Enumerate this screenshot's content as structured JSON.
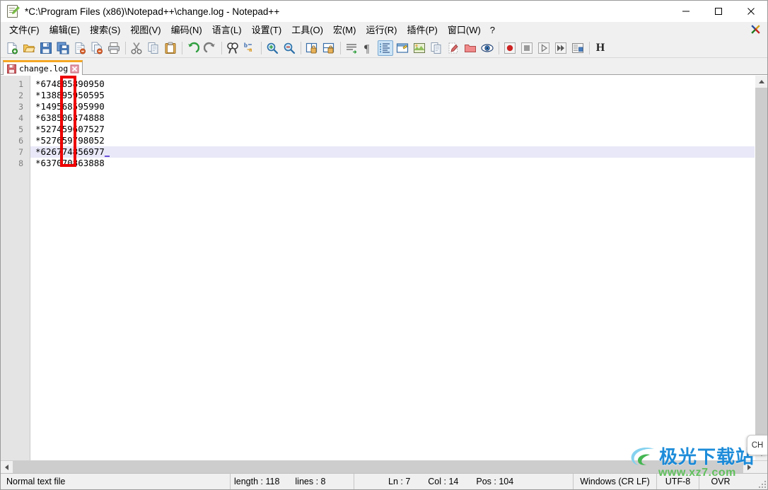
{
  "window": {
    "title": "*C:\\Program Files (x86)\\Notepad++\\change.log - Notepad++",
    "app_icon": "notepad-plus-plus-icon",
    "controls": {
      "minimize": "minimize-button",
      "maximize": "maximize-button",
      "close": "close-button"
    }
  },
  "menubar": {
    "items": [
      {
        "label": "文件(F)",
        "name": "menu-file"
      },
      {
        "label": "编辑(E)",
        "name": "menu-edit"
      },
      {
        "label": "搜索(S)",
        "name": "menu-search"
      },
      {
        "label": "视图(V)",
        "name": "menu-view"
      },
      {
        "label": "编码(N)",
        "name": "menu-encoding"
      },
      {
        "label": "语言(L)",
        "name": "menu-language"
      },
      {
        "label": "设置(T)",
        "name": "menu-settings"
      },
      {
        "label": "工具(O)",
        "name": "menu-tools"
      },
      {
        "label": "宏(M)",
        "name": "menu-macro"
      },
      {
        "label": "运行(R)",
        "name": "menu-run"
      },
      {
        "label": "插件(P)",
        "name": "menu-plugins"
      },
      {
        "label": "窗口(W)",
        "name": "menu-window"
      },
      {
        "label": "?",
        "name": "menu-help"
      }
    ],
    "close_document": "close-document-x-icon"
  },
  "toolbar": {
    "groups": [
      [
        "new-file-icon",
        "open-file-icon",
        "save-icon",
        "save-all-icon",
        "close-file-icon",
        "close-all-files-icon",
        "print-icon"
      ],
      [
        "cut-icon",
        "copy-icon",
        "paste-icon"
      ],
      [
        "undo-icon",
        "redo-icon"
      ],
      [
        "find-icon",
        "replace-icon"
      ],
      [
        "zoom-in-icon",
        "zoom-out-icon"
      ],
      [
        "sync-vertical-scrolling-icon",
        "sync-horizontal-scrolling-icon"
      ],
      [
        "word-wrap-icon",
        "show-all-characters-icon",
        "indent-guide-icon",
        "user-defined-dialog-icon",
        "document-map-icon",
        "document-list-icon",
        "function-list-icon",
        "folder-as-workspace-icon",
        "monitoring-icon"
      ],
      [
        "record-macro-icon",
        "stop-recording-icon",
        "play-macro-icon",
        "run-macro-multiple-times-icon",
        "save-current-macro-icon"
      ],
      [
        "highlight-icon"
      ]
    ],
    "active_tool": "indent-guide-icon"
  },
  "tabs": [
    {
      "label": "change.log",
      "modified": true,
      "active": true,
      "save_icon": "unsaved-save-icon",
      "close_icon": "tab-close-icon"
    }
  ],
  "editor": {
    "line_numbers": [
      "1",
      "2",
      "3",
      "4",
      "5",
      "6",
      "7",
      "8"
    ],
    "lines": [
      "*674885890950",
      "*138895950595",
      "*149568595990",
      "*638506374888",
      "*527459607527",
      "*527659798052",
      "*626774856977",
      "*637070863888"
    ],
    "current_line_index": 6,
    "caret_after_line": "*626774856977",
    "annotation": {
      "name": "red-highlight-rectangle",
      "color": "#ee0000"
    }
  },
  "ime": {
    "label": "CH"
  },
  "statusbar": {
    "file_type": "Normal text file",
    "length_label": "length : 118",
    "lines_label": "lines : 8",
    "ln": "Ln : 7",
    "col": "Col : 14",
    "pos": "Pos : 104",
    "eol": "Windows (CR LF)",
    "encoding": "UTF-8",
    "insert_mode": "OVR"
  },
  "watermark": {
    "text": "极光下载站",
    "url": "www.xz7.com"
  },
  "colors": {
    "accent_tab": "#f5a623",
    "annotation": "#ee0000",
    "current_line": "#e8e8f8",
    "caret": "#6a4fd8",
    "gutter_bg": "#e4e4e4"
  }
}
